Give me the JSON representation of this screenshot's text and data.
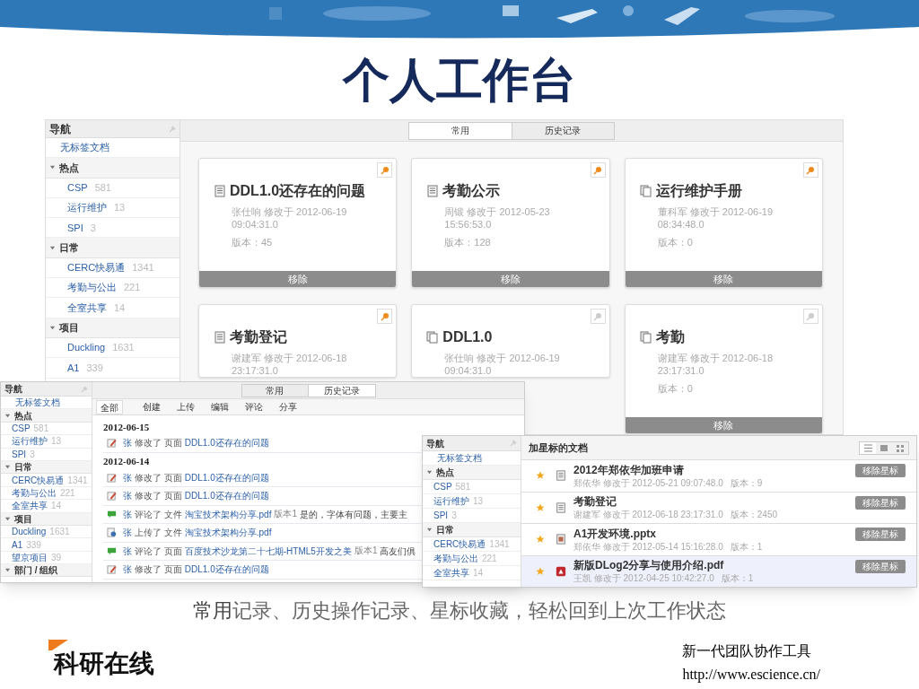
{
  "slide": {
    "title": "个人工作台",
    "caption": "**常用**记录、历史操作记录、星标收藏，轻松回到上次工作状态",
    "logo": "科研在线",
    "tagline": "新一代团队协作工具",
    "url": "http://www.escience.cn/"
  },
  "main_screen": {
    "nav": {
      "title": "导航",
      "items": [
        {
          "kind": "link",
          "label": "无标签文档"
        },
        {
          "kind": "group",
          "label": "热点",
          "expanded": true,
          "children": [
            {
              "label": "CSP",
              "count": "581"
            },
            {
              "label": "运行维护",
              "count": "13"
            },
            {
              "label": "SPI",
              "count": "3"
            }
          ]
        },
        {
          "kind": "group",
          "label": "日常",
          "expanded": true,
          "children": [
            {
              "label": "CERC快易通",
              "count": "1341"
            },
            {
              "label": "考勤与公出",
              "count": "221"
            },
            {
              "label": "全室共享",
              "count": "14"
            }
          ]
        },
        {
          "kind": "group",
          "label": "项目",
          "expanded": true,
          "children": [
            {
              "label": "Duckling",
              "count": "1631"
            },
            {
              "label": "A1",
              "count": "339"
            }
          ]
        }
      ]
    },
    "tabs": [
      {
        "label": "常用",
        "selected": true
      },
      {
        "label": "历史记录",
        "selected": false
      }
    ],
    "cards": [
      {
        "kind": "doc",
        "title": "DDL1.0还存在的问题",
        "author": "张仕响 修改于 2012-06-19",
        "time": "09:04:31.0",
        "version": "版本：45",
        "pinned": true,
        "button": "移除"
      },
      {
        "kind": "doc",
        "title": "考勤公示",
        "author": "周锻 修改于 2012-05-23",
        "time": "15:56:53.0",
        "version": "版本：128",
        "pinned": true,
        "button": "移除"
      },
      {
        "kind": "pages",
        "title": "运行维护手册",
        "author": "董科军 修改于 2012-06-19",
        "time": "08:34:48.0",
        "version": "版本：0",
        "pinned": true,
        "button": "移除"
      },
      {
        "kind": "doc",
        "title": "考勤登记",
        "author": "谢建军 修改于 2012-06-18",
        "time": "23:17:31.0",
        "pinned": true
      },
      {
        "kind": "pages",
        "title": "DDL1.0",
        "author": "张仕响 修改于 2012-06-19",
        "time": "09:04:31.0",
        "pinned": false
      },
      {
        "kind": "pages",
        "title": "考勤",
        "author": "谢建军 修改于 2012-06-18",
        "time": "23:17:31.0",
        "version": "版本：0",
        "pinned": false,
        "button": "移除"
      }
    ]
  },
  "history_screen": {
    "nav": {
      "title": "导航",
      "items": [
        {
          "kind": "link",
          "label": "无标签文档"
        },
        {
          "kind": "group",
          "label": "热点",
          "expanded": true,
          "children": [
            {
              "label": "CSP",
              "count": "581"
            },
            {
              "label": "运行维护",
              "count": "13"
            },
            {
              "label": "SPI",
              "count": "3"
            }
          ]
        },
        {
          "kind": "group",
          "label": "日常",
          "expanded": true,
          "children": [
            {
              "label": "CERC快易通",
              "count": "1341"
            },
            {
              "label": "考勤与公出",
              "count": "221"
            },
            {
              "label": "全室共享",
              "count": "14"
            }
          ]
        },
        {
          "kind": "group",
          "label": "项目",
          "expanded": true,
          "children": [
            {
              "label": "Duckling",
              "count": "1631"
            },
            {
              "label": "A1",
              "count": "339"
            },
            {
              "label": "望京项目",
              "count": "39"
            }
          ]
        },
        {
          "kind": "group",
          "label": "部门 / 组织",
          "expanded": true
        }
      ]
    },
    "tabs": [
      {
        "label": "常用",
        "selected": false
      },
      {
        "label": "历史记录",
        "selected": true
      }
    ],
    "filters": [
      {
        "label": "全部",
        "selected": true
      },
      {
        "label": "创建",
        "selected": false
      },
      {
        "label": "上传",
        "selected": false
      },
      {
        "label": "编辑",
        "selected": false
      },
      {
        "label": "评论",
        "selected": false
      },
      {
        "label": "分享",
        "selected": false
      }
    ],
    "days": [
      {
        "date": "2012-06-15",
        "entries": [
          {
            "kind": "edit",
            "actor": "张",
            "action": "修改了 页面",
            "link": "DDL1.0还存在的问题"
          }
        ]
      },
      {
        "date": "2012-06-14",
        "entries": [
          {
            "kind": "edit",
            "actor": "张",
            "action": "修改了 页面",
            "link": "DDL1.0还存在的问题"
          },
          {
            "kind": "edit",
            "actor": "张",
            "action": "修改了 页面",
            "link": "DDL1.0还存在的问题"
          },
          {
            "kind": "comment",
            "actor": "张",
            "action": "评论了 文件",
            "link": "淘宝技术架构分享.pdf",
            "version": "版本1",
            "comment": "是的，字体有问题，主要主"
          },
          {
            "kind": "upload",
            "actor": "张",
            "action": "上传了 文件",
            "link": "淘宝技术架构分享.pdf"
          },
          {
            "kind": "comment",
            "actor": "张",
            "action": "评论了 页面",
            "link": "百度技术沙龙第二十七期-HTML5开发之美",
            "version": "版本1",
            "comment": "高友们俱"
          },
          {
            "kind": "edit",
            "actor": "张",
            "action": "修改了 页面",
            "link": "DDL1.0还存在的问题"
          }
        ]
      }
    ]
  },
  "starred_screen": {
    "nav": {
      "title": "导航",
      "items": [
        {
          "kind": "link",
          "label": "无标签文档"
        },
        {
          "kind": "group",
          "label": "热点",
          "expanded": true,
          "children": [
            {
              "label": "CSP",
              "count": "581"
            },
            {
              "label": "运行维护",
              "count": "13"
            },
            {
              "label": "SPI",
              "count": "3"
            }
          ]
        },
        {
          "kind": "group",
          "label": "日常",
          "expanded": true,
          "children": [
            {
              "label": "CERC快易通",
              "count": "1341"
            },
            {
              "label": "考勤与公出",
              "count": "221"
            },
            {
              "label": "全室共享",
              "count": "14"
            }
          ]
        }
      ]
    },
    "title": "加星标的文档",
    "docs": [
      {
        "kind": "doc",
        "title": "2012年郑依华加班申请",
        "meta": "郑依华 修改于 2012-05-21 09:07:48.0",
        "version": "版本：9",
        "button": "移除星标",
        "selected": false
      },
      {
        "kind": "doc",
        "title": "考勤登记",
        "meta": "谢建军 修改于 2012-06-18 23:17:31.0",
        "version": "版本：2450",
        "button": "移除星标",
        "selected": false
      },
      {
        "kind": "pptx",
        "title": "A1开发环境.pptx",
        "meta": "郑依华 修改于 2012-05-14 15:16:28.0",
        "version": "版本：1",
        "button": "移除星标",
        "selected": false
      },
      {
        "kind": "pdf",
        "title": "新版DLog2分享与使用介绍.pdf",
        "meta": "王凯 修改于 2012-04-25 10:42:27.0",
        "version": "版本：1",
        "button": "移除星标",
        "selected": true
      }
    ]
  }
}
